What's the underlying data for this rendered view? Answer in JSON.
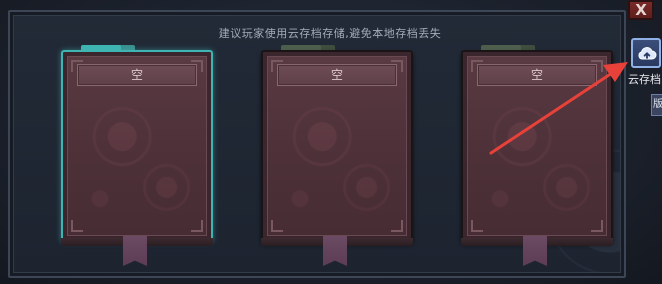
{
  "header": {
    "hint_text": "建议玩家使用云存档存储,避免本地存档丢失"
  },
  "save_slots": [
    {
      "label": "空",
      "selected": true
    },
    {
      "label": "空",
      "selected": false
    },
    {
      "label": "空",
      "selected": false
    }
  ],
  "controls": {
    "close_label": "X",
    "cloud_save_label": "云存档",
    "side_tab_label": "版"
  },
  "colors": {
    "selected_outline": "#3fb5b3",
    "annotation_arrow": "#e8413a",
    "cloud_button_border": "#8fb1e6"
  },
  "icons": {
    "cloud": "cloud-upload-icon",
    "close": "close-icon"
  }
}
